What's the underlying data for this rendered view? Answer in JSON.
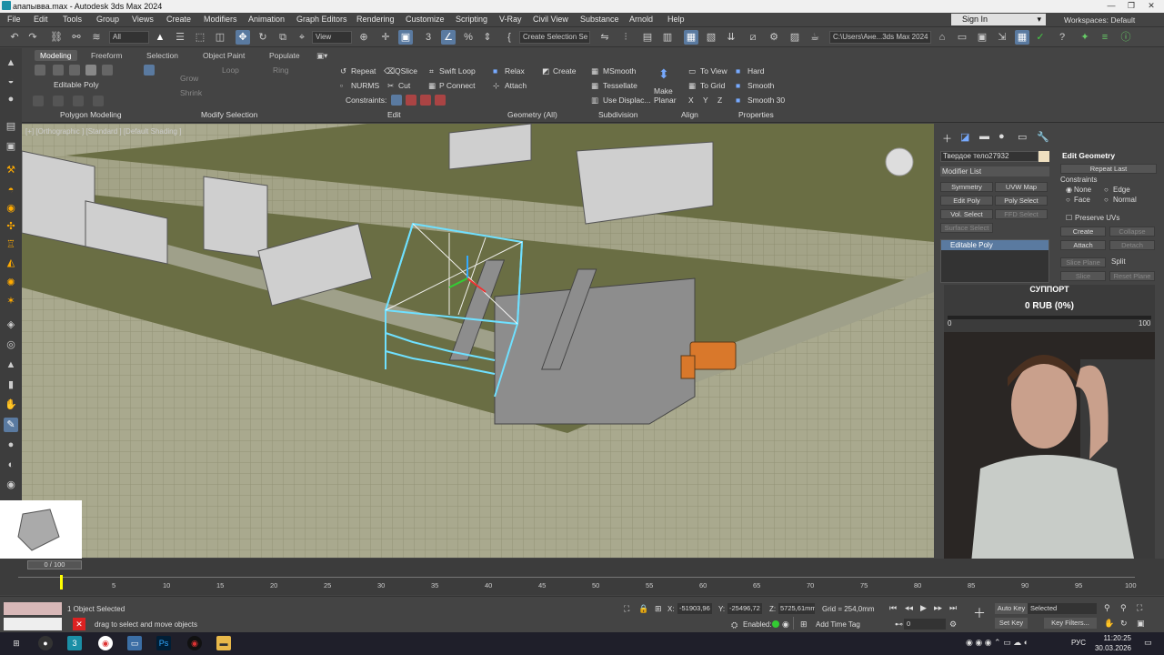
{
  "window": {
    "title": "апапывва.max - Autodesk 3ds Max 2024"
  },
  "menu": [
    "File",
    "Edit",
    "Tools",
    "Group",
    "Views",
    "Create",
    "Modifiers",
    "Animation",
    "Graph Editors",
    "Rendering",
    "Customize",
    "Scripting",
    "V-Ray",
    "Civil View",
    "Substance",
    "Arnold",
    "Help"
  ],
  "account": {
    "sign_in": "Sign In",
    "workspaces": "Workspaces: Default"
  },
  "toolbar": {
    "filter": "All",
    "view": "View",
    "selection_set": "Create Selection Se",
    "path": "C:\\Users\\Ане...3ds Max 2024"
  },
  "ribbon": {
    "tabs": [
      "Modeling",
      "Freeform",
      "Selection",
      "Object Paint",
      "Populate"
    ],
    "editable_poly": "Editable Poly",
    "grow": "Grow",
    "shrink": "Shrink",
    "loop": "Loop",
    "ring": "Ring",
    "repeat": "Repeat",
    "qslice": "QSlice",
    "swift_loop": "Swift Loop",
    "nurms": "NURMS",
    "cut": "Cut",
    "p_connect": "P Connect",
    "constraints": "Constraints:",
    "relax": "Relax",
    "create": "Create",
    "attach": "Attach",
    "msmooth": "MSmooth",
    "tessellate": "Tessellate",
    "use_displac": "Use Displac...",
    "make_planar": "Make Planar",
    "to_view": "To View",
    "to_grid": "To Grid",
    "x": "X",
    "y": "Y",
    "z": "Z",
    "hard": "Hard",
    "smooth": "Smooth",
    "smooth30": "Smooth 30",
    "panels": [
      "Polygon Modeling",
      "Modify Selection",
      "Edit",
      "Geometry (All)",
      "Subdivision",
      "Align",
      "Properties"
    ]
  },
  "viewport": {
    "label": "[+] [Orthographic ] [Standard ] [Default Shading ]"
  },
  "command_panel": {
    "object_name": "Твердое тело27932",
    "modifier_list": "Modifier List",
    "buttons": [
      "Symmetry",
      "UVW Map",
      "Edit Poly",
      "Poly Select",
      "Vol. Select",
      "FFD Select",
      "Surface Select"
    ],
    "stack_item": "Editable Poly",
    "rollout_title": "Edit Geometry",
    "repeat_last": "Repeat Last",
    "constraints": "Constraints",
    "c_none": "None",
    "c_edge": "Edge",
    "c_face": "Face",
    "c_normal": "Normal",
    "preserve_uvs": "Preserve UVs",
    "create": "Create",
    "collapse": "Collapse",
    "attach": "Attach",
    "detach": "Detach",
    "slice_plane": "Slice Plane",
    "split": "Split",
    "slice": "Slice",
    "reset_plane": "Reset Plane"
  },
  "donation": {
    "title": "СУППОРТ",
    "amount": "0 RUB (0%)",
    "min": "0",
    "max": "100",
    "progress": 0
  },
  "timeline": {
    "frame": "0 / 100",
    "ticks": [
      "5",
      "10",
      "15",
      "20",
      "25",
      "30",
      "35",
      "40",
      "45",
      "50",
      "55",
      "60",
      "65",
      "70",
      "75",
      "80",
      "85",
      "90",
      "95",
      "100"
    ]
  },
  "status": {
    "selected": "1 Object Selected",
    "prompt": "drag to select and move objects",
    "x": "-51903,96",
    "y": "-25496,72",
    "z": "5725,61mm",
    "grid": "Grid = 254,0mm",
    "enabled": "Enabled:",
    "add_time_tag": "Add Time Tag",
    "auto_key": "Auto Key",
    "set_key": "Set Key",
    "selected_dd": "Selected",
    "key_filters": "Key Filters...",
    "frame_value": "0"
  },
  "taskbar": {
    "lang": "РУС",
    "time": "11:20:25",
    "date": "30.03.2026"
  },
  "colors": {
    "viewport_ground": "#6a6e44",
    "accent": "#5a7aa0",
    "selection": "#6fe0ff"
  }
}
